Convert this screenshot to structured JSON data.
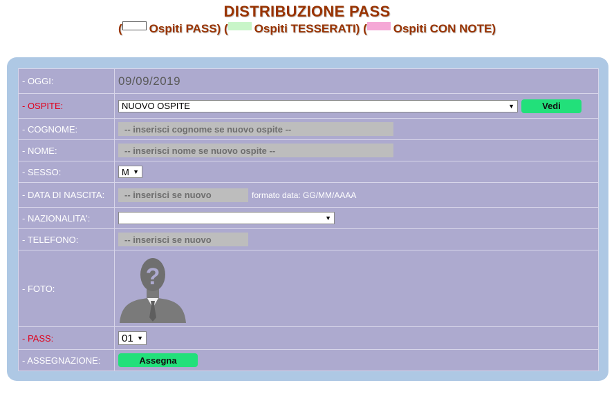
{
  "header": {
    "title": "DISTRIBUZIONE PASS",
    "legend": {
      "open1": "(",
      "pass_label": "Ospiti PASS)",
      "open2": "(",
      "tesserati_label": "Ospiti TESSERATI)",
      "open3": "(",
      "note_label": "Ospiti CON NOTE)"
    },
    "colors": {
      "pass": "#ffffff",
      "tesserati": "#c8f5c8",
      "note": "#f5a8d6"
    }
  },
  "form": {
    "oggi": {
      "label": "- OGGI:",
      "value": "09/09/2019"
    },
    "ospite": {
      "label": "- OSPITE:",
      "selected": "NUOVO OSPITE",
      "button": "Vedi"
    },
    "cognome": {
      "label": "- COGNOME:",
      "placeholder": "-- inserisci cognome se nuovo ospite --"
    },
    "nome": {
      "label": "- NOME:",
      "placeholder": "-- inserisci nome se nuovo ospite --"
    },
    "sesso": {
      "label": "- SESSO:",
      "selected": "M"
    },
    "data_nascita": {
      "label": "- DATA DI NASCITA:",
      "placeholder": "-- inserisci se nuovo",
      "hint": "formato data: GG/MM/AAAA"
    },
    "nazionalita": {
      "label": "- NAZIONALITA':",
      "selected": ""
    },
    "telefono": {
      "label": "- TELEFONO:",
      "placeholder": "-- inserisci se nuovo"
    },
    "foto": {
      "label": "- FOTO:",
      "icon": "unknown-person-icon"
    },
    "pass": {
      "label": "- PASS:",
      "selected": "01"
    },
    "assegnazione": {
      "label": "- ASSEGNAZIONE:",
      "button": "Assegna"
    }
  },
  "colors": {
    "panel": "#aec8e4",
    "form_bg": "#adaacf",
    "title": "#993300",
    "required_label": "#e0001b",
    "button_green": "#22e07a",
    "input_bg": "#bdbdbd"
  }
}
